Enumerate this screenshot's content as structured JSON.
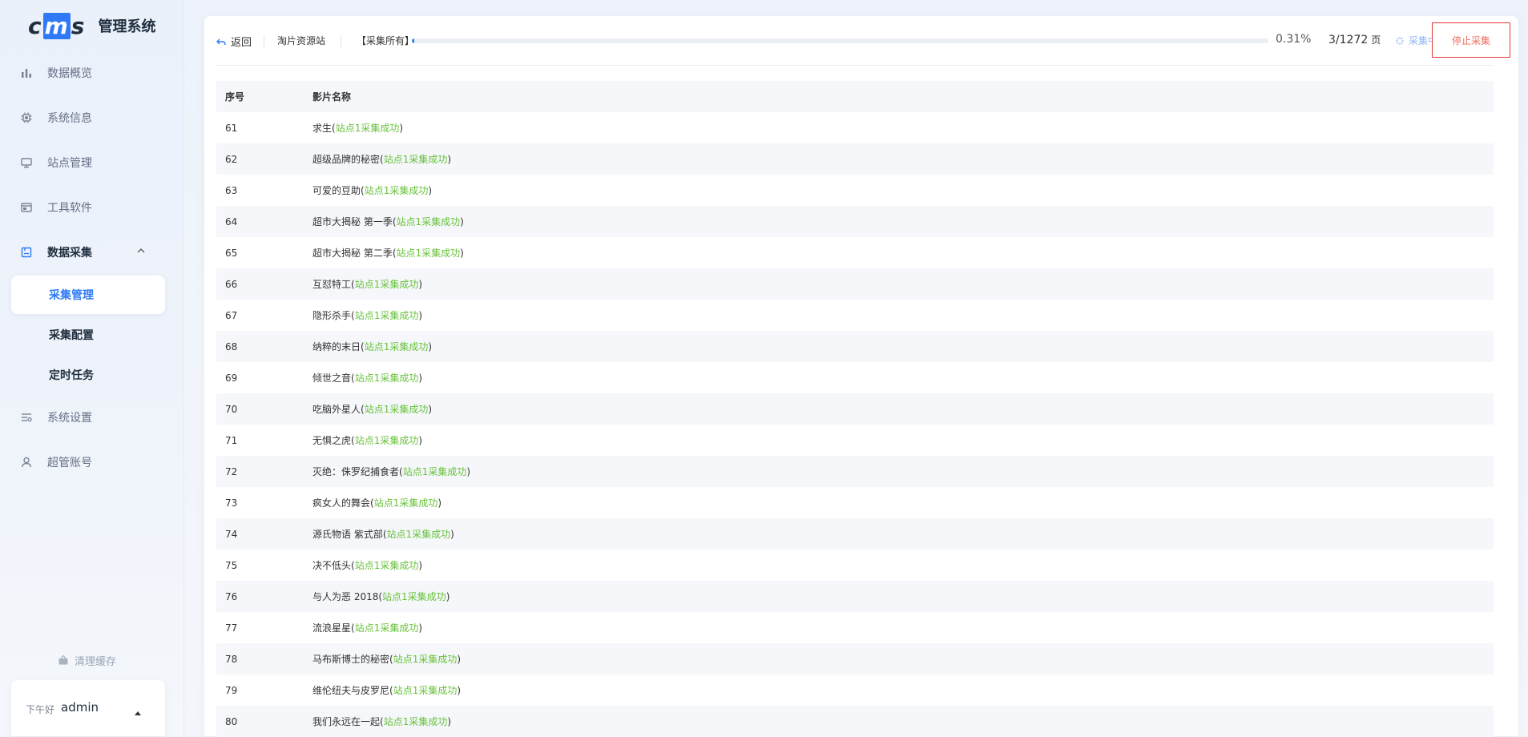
{
  "app": {
    "logo_text": "cms",
    "title": "管理系统"
  },
  "sidebar": {
    "items": [
      {
        "label": "数据概览",
        "icon": "bar-chart-icon"
      },
      {
        "label": "系统信息",
        "icon": "cpu-chip-icon"
      },
      {
        "label": "站点管理",
        "icon": "monitor-icon"
      },
      {
        "label": "工具软件",
        "icon": "window-icon"
      },
      {
        "label": "数据采集",
        "icon": "save-download-icon",
        "expanded": true,
        "active": true
      },
      {
        "label": "系统设置",
        "icon": "settings-sliders-icon"
      },
      {
        "label": "超管账号",
        "icon": "user-icon"
      }
    ],
    "sub_items": [
      {
        "label": "采集管理",
        "active": true
      },
      {
        "label": "采集配置"
      },
      {
        "label": "定时任务"
      }
    ],
    "clear_cache": "清理缓存",
    "user": {
      "greeting": "下午好",
      "name": "admin"
    }
  },
  "toolbar": {
    "back_label": "返回",
    "source_name": "淘片资源站",
    "collect_label": "【采集所有】",
    "progress_percent": 0.31,
    "percent_text": "0.31%",
    "pages_text": "3/1272",
    "pages_unit": "页",
    "status_text": "采集中",
    "stop_label": "停止采集"
  },
  "table": {
    "headers": [
      "序号",
      "影片名称"
    ],
    "rows": [
      {
        "id": "61",
        "title": "求生",
        "status": "站点1采集成功"
      },
      {
        "id": "62",
        "title": "超级品牌的秘密",
        "status": "站点1采集成功"
      },
      {
        "id": "63",
        "title": "可爱的豆助",
        "status": "站点1采集成功"
      },
      {
        "id": "64",
        "title": "超市大揭秘 第一季",
        "status": "站点1采集成功"
      },
      {
        "id": "65",
        "title": "超市大揭秘 第二季",
        "status": "站点1采集成功"
      },
      {
        "id": "66",
        "title": "互怼特工",
        "status": "站点1采集成功"
      },
      {
        "id": "67",
        "title": "隐形杀手",
        "status": "站点1采集成功"
      },
      {
        "id": "68",
        "title": "纳粹的末日",
        "status": "站点1采集成功"
      },
      {
        "id": "69",
        "title": "倾世之音",
        "status": "站点1采集成功"
      },
      {
        "id": "70",
        "title": "吃脑外星人",
        "status": "站点1采集成功"
      },
      {
        "id": "71",
        "title": "无惧之虎",
        "status": "站点1采集成功"
      },
      {
        "id": "72",
        "title": "灭绝：侏罗纪捕食者",
        "status": "站点1采集成功"
      },
      {
        "id": "73",
        "title": "疯女人的舞会",
        "status": "站点1采集成功"
      },
      {
        "id": "74",
        "title": "源氏物语 紫式部",
        "status": "站点1采集成功"
      },
      {
        "id": "75",
        "title": "决不低头",
        "status": "站点1采集成功"
      },
      {
        "id": "76",
        "title": "与人为恶 2018",
        "status": "站点1采集成功"
      },
      {
        "id": "77",
        "title": "流浪星星",
        "status": "站点1采集成功"
      },
      {
        "id": "78",
        "title": "马布斯博士的秘密",
        "status": "站点1采集成功"
      },
      {
        "id": "79",
        "title": "维伦纽夫与皮罗尼",
        "status": "站点1采集成功"
      },
      {
        "id": "80",
        "title": "我们永远在一起",
        "status": "站点1采集成功"
      }
    ]
  },
  "colors": {
    "accent": "#2f7cf6",
    "success": "#67c23a",
    "danger": "#e53935"
  }
}
